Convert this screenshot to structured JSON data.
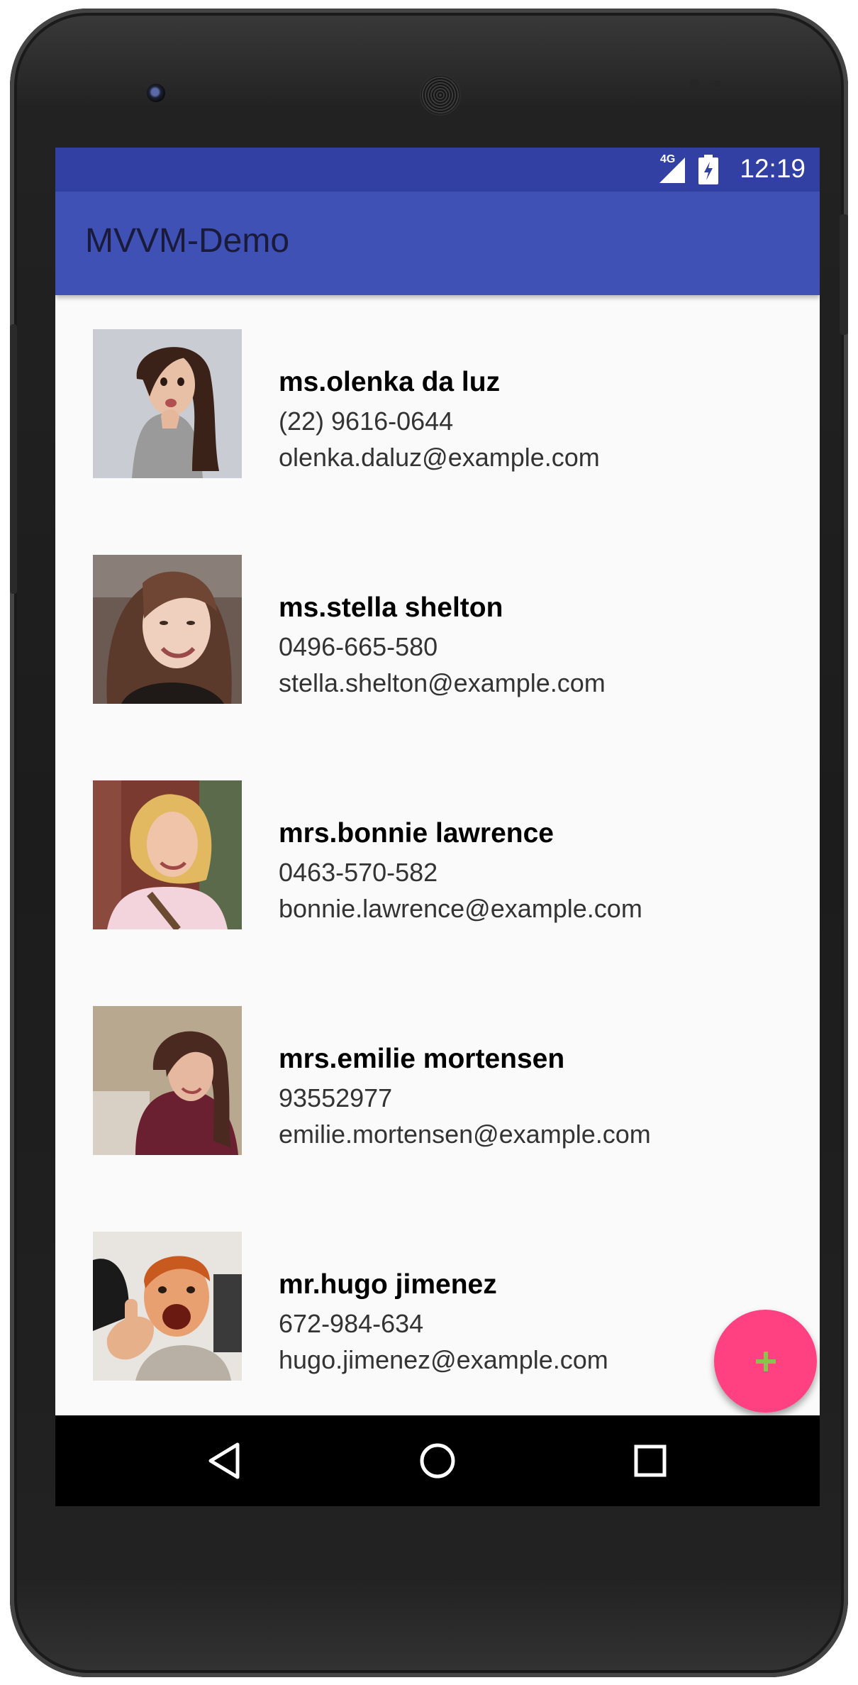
{
  "status_bar": {
    "network_label": "4G",
    "time": "12:19"
  },
  "app_bar": {
    "title": "MVVM-Demo"
  },
  "contacts": [
    {
      "name": "ms.olenka da luz",
      "phone": "(22) 9616-0644",
      "email": "olenka.daluz@example.com"
    },
    {
      "name": "ms.stella shelton",
      "phone": "0496-665-580",
      "email": "stella.shelton@example.com"
    },
    {
      "name": "mrs.bonnie lawrence",
      "phone": "0463-570-582",
      "email": "bonnie.lawrence@example.com"
    },
    {
      "name": "mrs.emilie mortensen",
      "phone": "93552977",
      "email": "emilie.mortensen@example.com"
    },
    {
      "name": "mr.hugo jimenez",
      "phone": "672-984-634",
      "email": "hugo.jimenez@example.com"
    }
  ],
  "fab": {
    "icon": "plus-icon",
    "icon_color": "#8bc34a",
    "color": "#ff4081"
  },
  "nav_bar": {
    "back_icon": "back-triangle-icon",
    "home_icon": "home-circle-icon",
    "recents_icon": "recents-square-icon"
  },
  "colors": {
    "status_bar": "#3140a2",
    "app_bar": "#3f51b5",
    "list_background": "#fafafa"
  }
}
